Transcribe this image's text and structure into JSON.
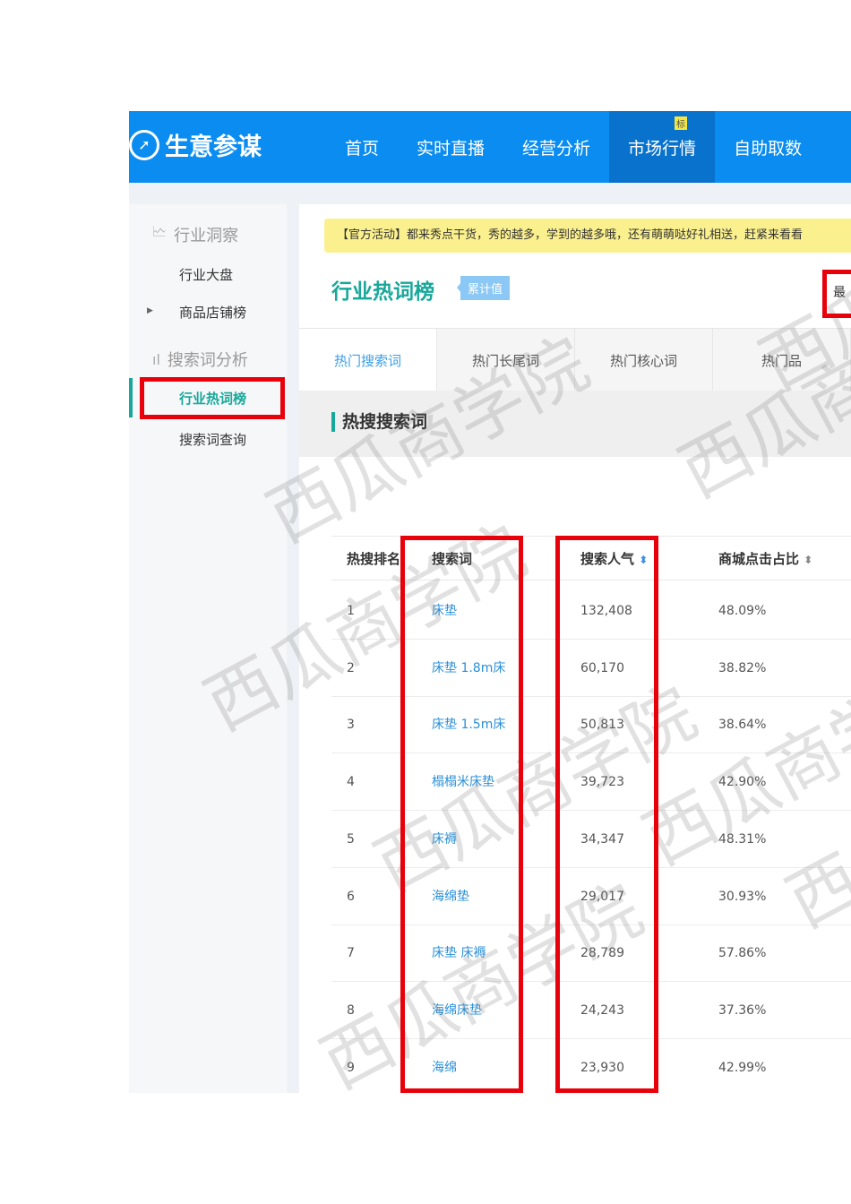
{
  "header": {
    "logo": "生意参谋",
    "nav": [
      {
        "label": "首页"
      },
      {
        "label": "实时直播"
      },
      {
        "label": "经营分析"
      },
      {
        "label": "市场行情",
        "badge": "标"
      },
      {
        "label": "自助取数"
      }
    ]
  },
  "sidebar": {
    "group1": "行业洞察",
    "item1": "行业大盘",
    "item2": "商品店铺榜",
    "group2": "搜索词分析",
    "item3": "行业热词榜",
    "item4": "搜索词查询"
  },
  "main": {
    "notice": "【官方活动】都来秀点干货，秀的越多，学到的越多哦，还有萌萌哒好礼相送，赶紧来看看",
    "title": "行业热词榜",
    "tag": "累计值",
    "corner": "最",
    "tabs": [
      "热门搜索词",
      "热门长尾词",
      "热门核心词",
      "热门品"
    ],
    "section": "热搜搜索词",
    "columns": [
      "热搜排名",
      "搜索词",
      "搜索人气",
      "商城点击占比"
    ],
    "rows": [
      {
        "rank": "1",
        "keyword": "床垫",
        "popularity": "132,408",
        "ratio": "48.09%"
      },
      {
        "rank": "2",
        "keyword": "床垫 1.8m床",
        "popularity": "60,170",
        "ratio": "38.82%"
      },
      {
        "rank": "3",
        "keyword": "床垫 1.5m床",
        "popularity": "50,813",
        "ratio": "38.64%"
      },
      {
        "rank": "4",
        "keyword": "榻榻米床垫",
        "popularity": "39,723",
        "ratio": "42.90%"
      },
      {
        "rank": "5",
        "keyword": "床褥",
        "popularity": "34,347",
        "ratio": "48.31%"
      },
      {
        "rank": "6",
        "keyword": "海绵垫",
        "popularity": "29,017",
        "ratio": "30.93%"
      },
      {
        "rank": "7",
        "keyword": "床垫 床褥",
        "popularity": "28,789",
        "ratio": "57.86%"
      },
      {
        "rank": "8",
        "keyword": "海绵床垫",
        "popularity": "24,243",
        "ratio": "37.36%"
      },
      {
        "rank": "9",
        "keyword": "海绵",
        "popularity": "23,930",
        "ratio": "42.99%"
      }
    ]
  },
  "watermark": "西瓜商学院",
  "colors": {
    "brand": "#0a8cf0",
    "accent": "#18a89a",
    "highlight": "#e8000a"
  }
}
